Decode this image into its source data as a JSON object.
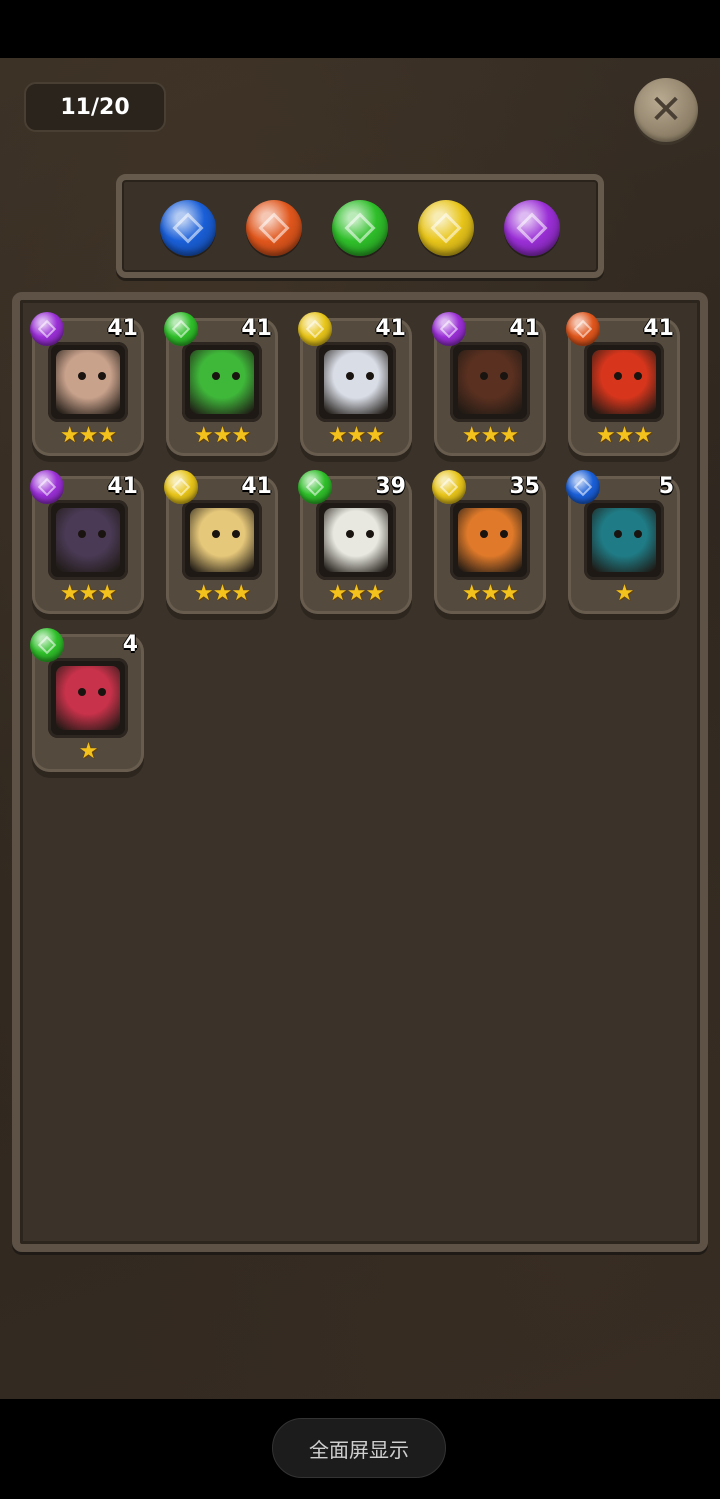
{
  "header": {
    "count_label": "11/20",
    "close_icon": "close-icon"
  },
  "filters": [
    {
      "name": "water",
      "color": "#1a5fd8"
    },
    {
      "name": "fire",
      "color": "#e0561c"
    },
    {
      "name": "wood",
      "color": "#2fbf2a"
    },
    {
      "name": "light",
      "color": "#e8c51a"
    },
    {
      "name": "dark",
      "color": "#9a2fd6"
    }
  ],
  "attribute_colors": {
    "dark": "#9a2fd6",
    "wood": "#2fbf2a",
    "light": "#e8c51a",
    "fire": "#e0561c",
    "water": "#1a5fd8"
  },
  "monsters": [
    {
      "level": "41",
      "attribute": "dark",
      "stars": 3,
      "portrait": "horned-girl-portrait",
      "tint": "#c9a28c"
    },
    {
      "level": "41",
      "attribute": "wood",
      "stars": 3,
      "portrait": "green-hood-portrait",
      "tint": "#3fb83a"
    },
    {
      "level": "41",
      "attribute": "light",
      "stars": 3,
      "portrait": "white-angel-portrait",
      "tint": "#d9dde6"
    },
    {
      "level": "41",
      "attribute": "dark",
      "stars": 3,
      "portrait": "dark-dragon-portrait",
      "tint": "#5a3020"
    },
    {
      "level": "41",
      "attribute": "fire",
      "stars": 3,
      "portrait": "red-dragon-portrait",
      "tint": "#d8361c"
    },
    {
      "level": "41",
      "attribute": "dark",
      "stars": 3,
      "portrait": "shadow-beast-portrait",
      "tint": "#4a3a55"
    },
    {
      "level": "41",
      "attribute": "light",
      "stars": 3,
      "portrait": "blonde-knight-portrait",
      "tint": "#e6c87a"
    },
    {
      "level": "39",
      "attribute": "wood",
      "stars": 3,
      "portrait": "panda-portrait",
      "tint": "#e8e8e0"
    },
    {
      "level": "35",
      "attribute": "light",
      "stars": 3,
      "portrait": "tiger-portrait",
      "tint": "#e07a2a"
    },
    {
      "level": "5",
      "attribute": "water",
      "stars": 1,
      "portrait": "teal-fish-portrait",
      "tint": "#1f7c86"
    },
    {
      "level": "4",
      "attribute": "wood",
      "stars": 1,
      "portrait": "red-blob-portrait",
      "tint": "#c8324a"
    }
  ],
  "footer": {
    "fullscreen_label": "全面屏显示"
  }
}
